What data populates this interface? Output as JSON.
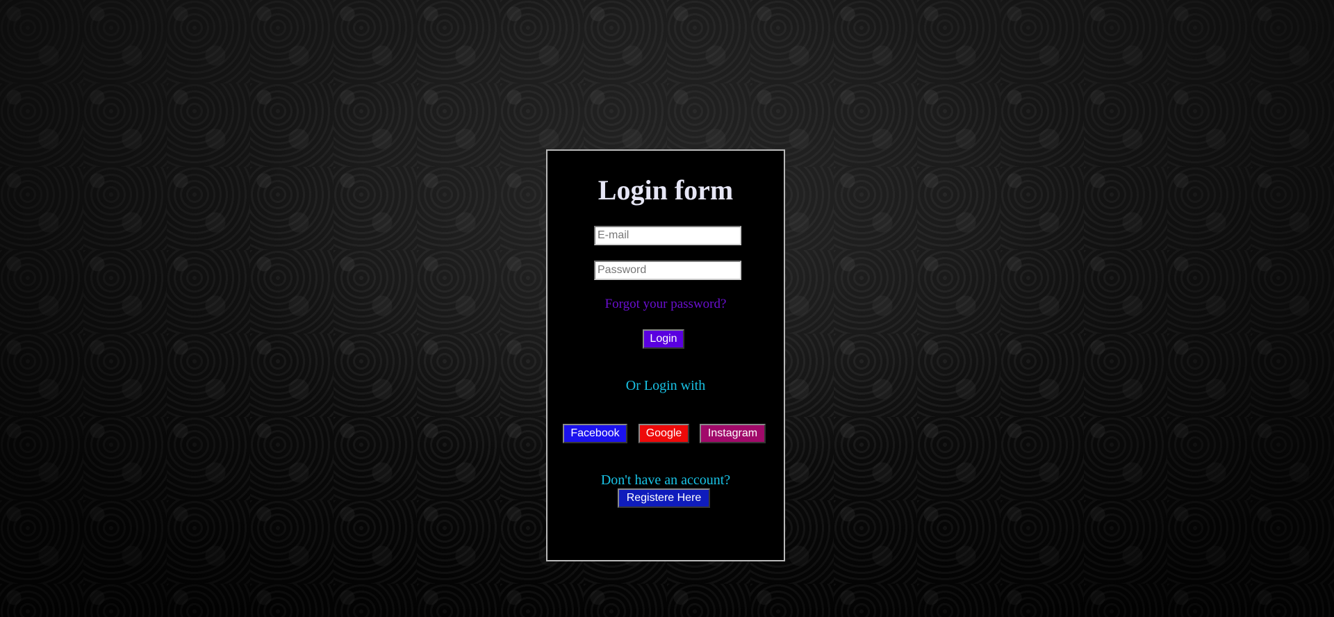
{
  "form": {
    "title": "Login form",
    "email_placeholder": "E-mail",
    "password_placeholder": "Password",
    "forgot_link": "Forgot your password?",
    "login_label": "Login",
    "or_text": "Or Login with",
    "social": {
      "facebook_label": "Facebook",
      "google_label": "Google",
      "instagram_label": "Instagram"
    },
    "no_account_text": "Don't have an account?",
    "register_label": "Registere Here"
  },
  "colors": {
    "background": "#0a0a0a",
    "card": "#000000",
    "card_border": "#b9b9b9",
    "title": "#e6e6f5",
    "forgot_link": "#6a0fd0",
    "login_button": "#5a00e0",
    "accent_text": "#19c3e6",
    "facebook": "#1b12ee",
    "google": "#ee0a0a",
    "instagram": "#a10a6a",
    "register_button": "#0f1cbc"
  }
}
